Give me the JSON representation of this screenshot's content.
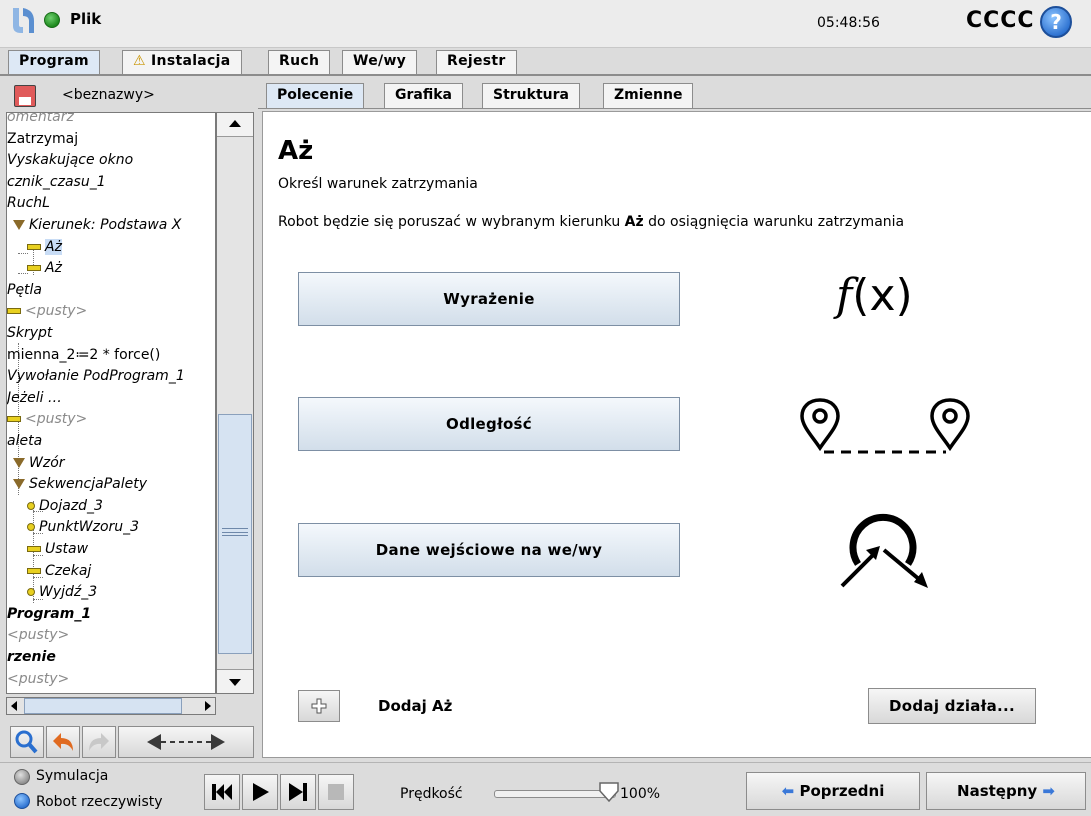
{
  "header": {
    "menu_label": "Plik",
    "time": "05:48:56",
    "robot_name": "CCCC",
    "help_symbol": "?"
  },
  "main_tabs": [
    {
      "label": "Program",
      "active": true
    },
    {
      "label": "Instalacja",
      "warning": true
    },
    {
      "label": "Ruch"
    },
    {
      "label": "We/wy"
    },
    {
      "label": "Rejestr"
    }
  ],
  "program": {
    "name": "<beznazwy>"
  },
  "tree": [
    {
      "text": "omentarz",
      "style": "gray"
    },
    {
      "text": "Zatrzymaj",
      "style": "plain"
    },
    {
      "text": "Vyskakujące okno",
      "style": "italic"
    },
    {
      "text": "cznik_czasu_1",
      "style": "italic"
    },
    {
      "text": "RuchL",
      "style": "italic"
    },
    {
      "text": "Kierunek: Podstawa X",
      "style": "italic",
      "icon": "tri"
    },
    {
      "text": "Aż",
      "style": "italic",
      "icon": "bar",
      "selected": true
    },
    {
      "text": "Aż",
      "style": "italic",
      "icon": "bar"
    },
    {
      "text": "Pętla",
      "style": "italic"
    },
    {
      "text": "<pusty>",
      "style": "gray",
      "icon": "bar"
    },
    {
      "text": "Skrypt",
      "style": "italic"
    },
    {
      "text": "mienna_2≔2 * force()",
      "style": "plain"
    },
    {
      "text": "Vywołanie PodProgram_1",
      "style": "italic"
    },
    {
      "text": "Jeżeli …",
      "style": "italic"
    },
    {
      "text": "<pusty>",
      "style": "gray",
      "icon": "bar"
    },
    {
      "text": "aleta",
      "style": "italic"
    },
    {
      "text": "Wzór",
      "style": "italic",
      "icon": "tri"
    },
    {
      "text": "SekwencjaPalety",
      "style": "italic",
      "icon": "tri"
    },
    {
      "text": "Dojazd_3",
      "style": "italic",
      "icon": "dot"
    },
    {
      "text": "PunktWzoru_3",
      "style": "italic",
      "icon": "dot"
    },
    {
      "text": "Ustaw",
      "style": "italic",
      "icon": "bar"
    },
    {
      "text": "Czekaj",
      "style": "italic",
      "icon": "bar"
    },
    {
      "text": "Wyjdź_3",
      "style": "italic",
      "icon": "dot"
    },
    {
      "text": "Program_1",
      "style": "bold"
    },
    {
      "text": "<pusty>",
      "style": "gray"
    },
    {
      "text": "rzenie",
      "style": "bold"
    },
    {
      "text": "<pusty>",
      "style": "gray"
    }
  ],
  "sub_tabs": [
    {
      "label": "Polecenie",
      "active": true
    },
    {
      "label": "Grafika"
    },
    {
      "label": "Struktura"
    },
    {
      "label": "Zmienne"
    }
  ],
  "command": {
    "title": "Aż",
    "subtitle": "Określ warunek zatrzymania",
    "desc_before": "Robot będzie się poruszać w wybranym kierunku ",
    "desc_bold": "Aż",
    "desc_after": " do osiągnięcia warunku zatrzymania",
    "options": [
      {
        "label": "Wyrażenie",
        "icon": "function-icon"
      },
      {
        "label": "Odległość",
        "icon": "distance-icon"
      },
      {
        "label": "Dane wejściowe na we/wy",
        "icon": "io-input-icon"
      }
    ],
    "fx_f": "f",
    "fx_rest": "(x)",
    "add_until": "Dodaj Aż",
    "add_action": "Dodaj działa..."
  },
  "footer": {
    "simulation": "Symulacja",
    "real_robot": "Robot rzeczywisty",
    "speed_label": "Prędkość",
    "speed_value": "100%",
    "speed_fraction": 1.0,
    "prev": "Poprzedni",
    "next": "Następny"
  },
  "colors": {
    "accent": "#3a78d8",
    "selection": "#c8dcf5",
    "node_icon": "#e8d020"
  }
}
